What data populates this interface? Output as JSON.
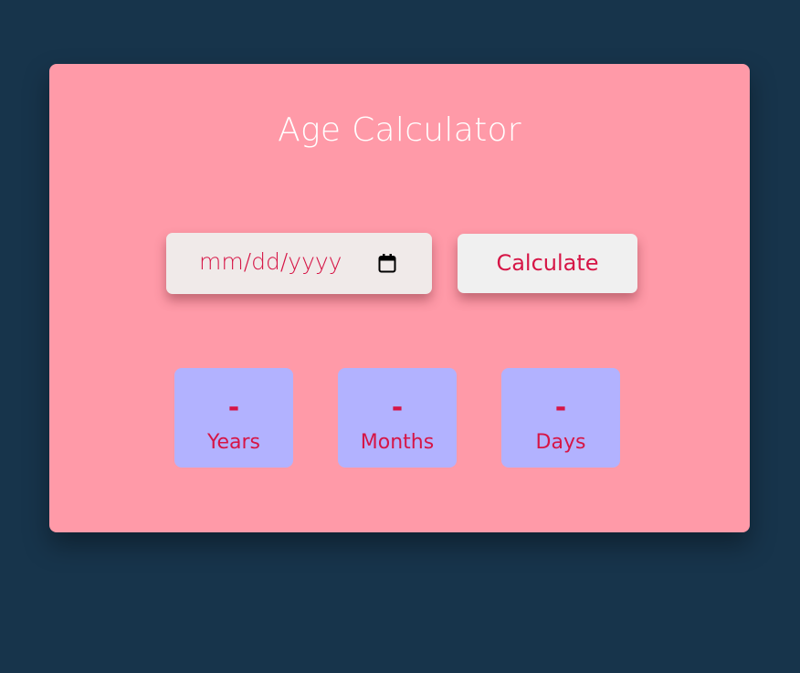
{
  "app": {
    "title": "Age Calculator"
  },
  "input": {
    "placeholder": "mm/dd/yyyy",
    "icon": "calendar-icon"
  },
  "button": {
    "calculate_label": "Calculate"
  },
  "results": [
    {
      "value": "-",
      "label": "Years"
    },
    {
      "value": "-",
      "label": "Months"
    },
    {
      "value": "-",
      "label": "Days"
    }
  ],
  "colors": {
    "background": "#17344b",
    "card": "#ff9aa8",
    "accent": "#d61546",
    "result_box": "#b2b2ff",
    "input_bg": "#f0eae9",
    "button_bg": "#f0f0f0",
    "title_text": "#ffffff"
  }
}
